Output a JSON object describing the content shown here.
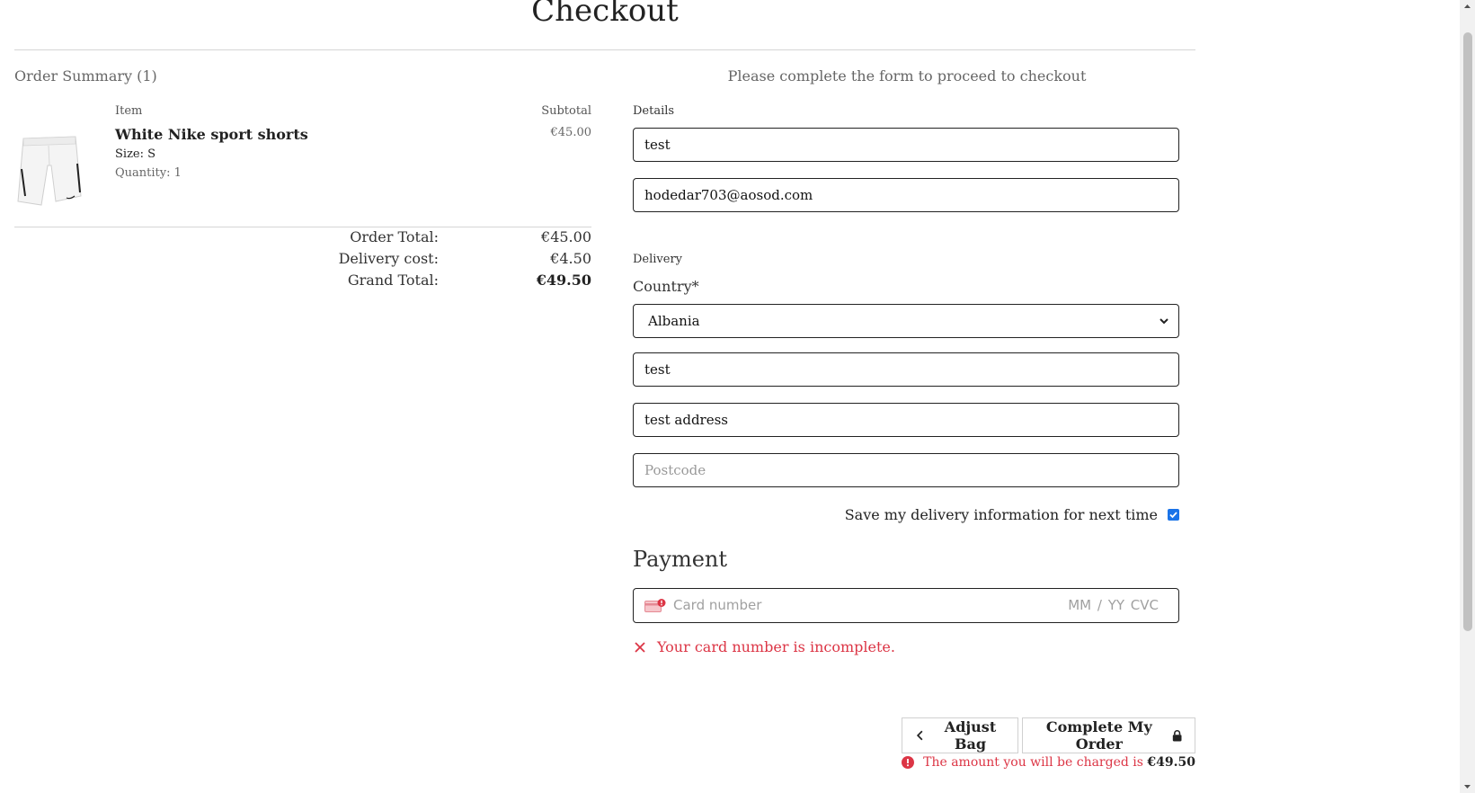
{
  "page_title": "Checkout",
  "order_summary": {
    "heading": "Order Summary (1)",
    "col_item": "Item",
    "col_subtotal": "Subtotal",
    "items": [
      {
        "name": "White Nike sport shorts",
        "size": "Size: S",
        "quantity": "Quantity: 1",
        "subtotal": "€45.00",
        "image_icon": "white-shorts-product-image"
      }
    ],
    "totals": {
      "order_total_label": "Order Total:",
      "order_total": "€45.00",
      "delivery_label": "Delivery cost:",
      "delivery": "€4.50",
      "grand_label": "Grand Total:",
      "grand": "€49.50"
    }
  },
  "form": {
    "intro": "Please complete the form to proceed to checkout",
    "details_legend": "Details",
    "full_name_value": "test",
    "email_value": "hodedar703@aosod.com",
    "delivery_legend": "Delivery",
    "country_label": "Country*",
    "country_value": "Albania",
    "town_value": "test",
    "address_value": "test address",
    "postcode_placeholder": "Postcode",
    "save_info_label": "Save my delivery information for next time",
    "save_info_checked": true
  },
  "payment": {
    "heading": "Payment",
    "card_placeholder": "Card number",
    "expiry_cvc_placeholder": "MM / YY  CVC",
    "error_text": "Your card number is incomplete.",
    "error_color": "#dc3545"
  },
  "actions": {
    "adjust_label": "Adjust Bag",
    "complete_label": "Complete My Order",
    "charge_text": "The amount you will be charged is",
    "charge_amount": "€49.50"
  }
}
